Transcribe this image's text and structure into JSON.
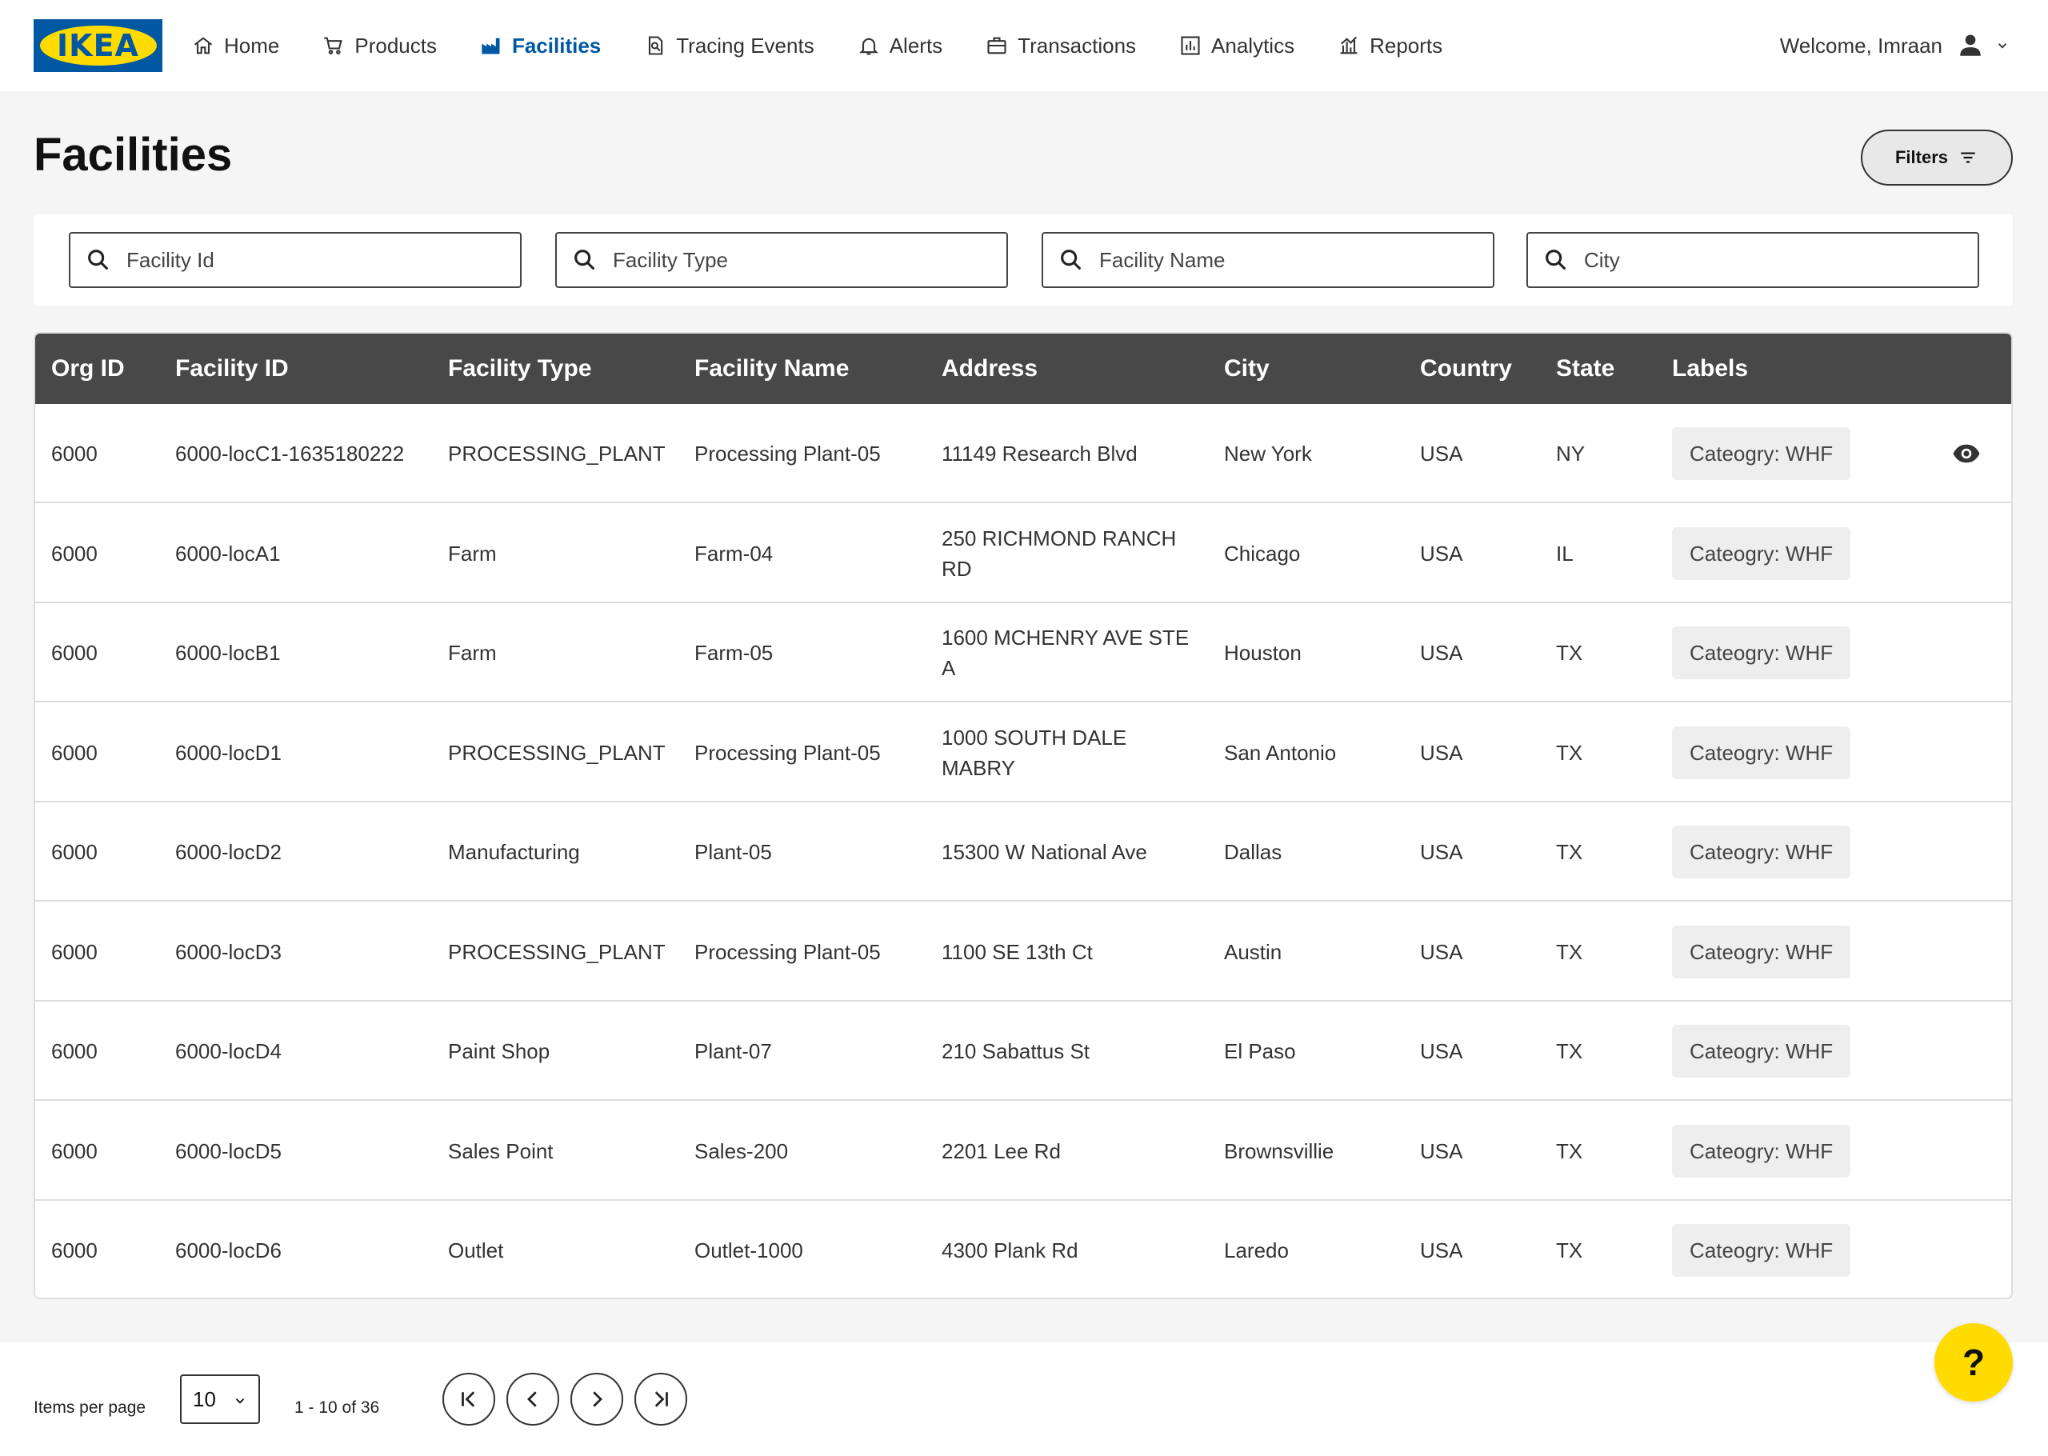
{
  "brand": {
    "logo_text": "IKEA",
    "primary": "#0058a3",
    "accent": "#ffdb00"
  },
  "nav": {
    "items": [
      {
        "label": "Home",
        "icon": "home-icon"
      },
      {
        "label": "Products",
        "icon": "cart-icon"
      },
      {
        "label": "Facilities",
        "icon": "factory-icon",
        "active": true
      },
      {
        "label": "Tracing Events",
        "icon": "tracing-icon"
      },
      {
        "label": "Alerts",
        "icon": "bell-icon"
      },
      {
        "label": "Transactions",
        "icon": "briefcase-icon"
      },
      {
        "label": "Analytics",
        "icon": "chart-icon"
      },
      {
        "label": "Reports",
        "icon": "report-icon"
      }
    ],
    "welcome": "Welcome, Imraan"
  },
  "page": {
    "title": "Facilities",
    "filters_label": "Filters"
  },
  "search": {
    "facility_id": "Facility Id",
    "facility_type": "Facility Type",
    "facility_name": "Facility Name",
    "city": "City"
  },
  "table": {
    "columns": [
      "Org ID",
      "Facility ID",
      "Facility Type",
      "Facility Name",
      "Address",
      "City",
      "Country",
      "State",
      "Labels"
    ],
    "rows": [
      {
        "org": "6000",
        "id": "6000-locC1-1635180222",
        "type": "PROCESSING_PLANT",
        "name": "Processing Plant-05",
        "address": "11149 Research Blvd",
        "city": "New York",
        "country": "USA",
        "state": "NY",
        "label": "Cateogry: WHF"
      },
      {
        "org": "6000",
        "id": "6000-locA1",
        "type": "Farm",
        "name": "Farm-04",
        "address": "250 RICHMOND RANCH RD",
        "city": "Chicago",
        "country": "USA",
        "state": "IL",
        "label": "Cateogry: WHF"
      },
      {
        "org": "6000",
        "id": "6000-locB1",
        "type": "Farm",
        "name": "Farm-05",
        "address": "1600 MCHENRY AVE STE A",
        "city": "Houston",
        "country": "USA",
        "state": "TX",
        "label": "Cateogry: WHF"
      },
      {
        "org": "6000",
        "id": "6000-locD1",
        "type": "PROCESSING_PLANT",
        "name": "Processing Plant-05",
        "address": "1000 SOUTH DALE MABRY",
        "city": "San Antonio",
        "country": "USA",
        "state": "TX",
        "label": "Cateogry: WHF"
      },
      {
        "org": "6000",
        "id": "6000-locD2",
        "type": "Manufacturing",
        "name": "Plant-05",
        "address": "15300 W National Ave",
        "city": "Dallas",
        "country": "USA",
        "state": "TX",
        "label": "Cateogry: WHF"
      },
      {
        "org": "6000",
        "id": "6000-locD3",
        "type": "PROCESSING_PLANT",
        "name": "Processing Plant-05",
        "address": "1100 SE 13th Ct",
        "city": "Austin",
        "country": "USA",
        "state": "TX",
        "label": "Cateogry: WHF"
      },
      {
        "org": "6000",
        "id": "6000-locD4",
        "type": "Paint Shop",
        "name": "Plant-07",
        "address": "210 Sabattus St",
        "city": "El Paso",
        "country": "USA",
        "state": "TX",
        "label": "Cateogry: WHF"
      },
      {
        "org": "6000",
        "id": "6000-locD5",
        "type": "Sales Point",
        "name": "Sales-200",
        "address": "2201 Lee Rd",
        "city": "Brownsvillie",
        "country": "USA",
        "state": "TX",
        "label": "Cateogry: WHF"
      },
      {
        "org": "6000",
        "id": "6000-locD6",
        "type": "Outlet",
        "name": "Outlet-1000",
        "address": "4300 Plank Rd",
        "city": "Laredo",
        "country": "USA",
        "state": "TX",
        "label": "Cateogry: WHF"
      }
    ]
  },
  "pagination": {
    "items_per_page_label": "Items per page",
    "items_per_page": "10",
    "range": "1 - 10 of 36"
  },
  "help_label": "?"
}
